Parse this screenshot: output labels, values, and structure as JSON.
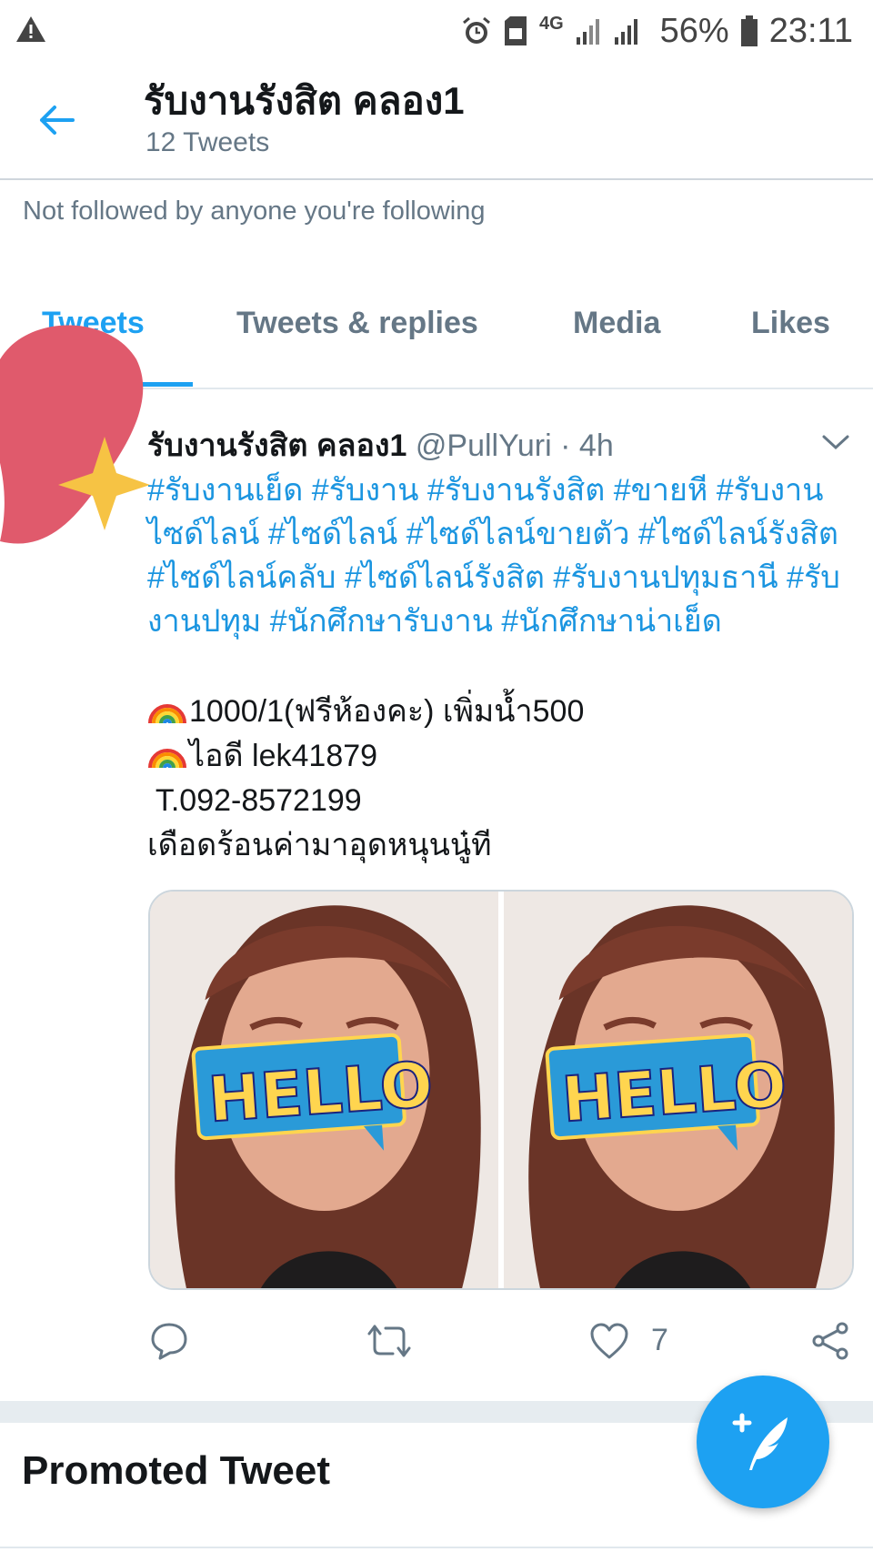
{
  "status_bar": {
    "battery": "56%",
    "time": "23:11",
    "network": "4G",
    "icons": [
      "warning-icon",
      "alarm-icon",
      "sim-icon",
      "signal-icon",
      "battery-icon"
    ]
  },
  "header": {
    "title": "รับงานรังสิต คลอง1",
    "tweet_count": "12 Tweets"
  },
  "profile": {
    "followers_note": "Not followed by anyone you're following"
  },
  "tabs": [
    {
      "label": "Tweets",
      "active": true
    },
    {
      "label": "Tweets & replies",
      "active": false
    },
    {
      "label": "Media",
      "active": false
    },
    {
      "label": "Likes",
      "active": false
    }
  ],
  "tweet": {
    "name": "รับงานรังสิต คลอง1",
    "handle": "@PullYuri",
    "dot": "·",
    "time": "4h",
    "hashtags_text": "#รับงานเย็ด #รับงาน #รับงานรังสิต #ขายหี #รับงานไซด์ไลน์ #ไซด์ไลน์ #ไซด์ไลน์ขายตัว #ไซด์ไลน์รังสิต #ไซด์ไลน์คลับ #ไซด์ไลน์รังสิต #รับงานปทุมธานี #รับงานปทุม #นักศึกษารับงาน #นักศึกษาน่าเย็ด",
    "line1": "1000/1(ฟรีห้องคะ) เพิ่มน้ำ500",
    "line2": "ไอดี lek41879",
    "line3": " T.092-8572199",
    "line4": "เดือดร้อนค่ามาอุดหนุนนู๋ที",
    "photo_sticker_text": "HELLO",
    "like_count": "7"
  },
  "promoted": {
    "label": "Promoted Tweet"
  },
  "colors": {
    "accent": "#1da1f2",
    "link": "#1b95e0",
    "muted": "#657786",
    "heart_sticker": "#e05a6c",
    "star_sticker": "#f6c344"
  }
}
